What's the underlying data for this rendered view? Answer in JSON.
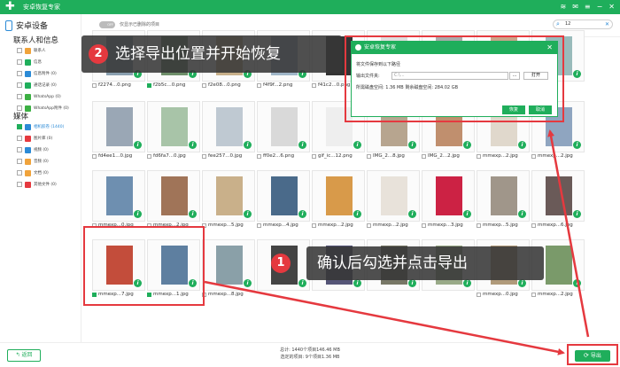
{
  "window": {
    "title": "安卓恢复专家"
  },
  "sidebar": {
    "device_label": "安卓设备",
    "section_contacts": "联系人和信息",
    "contacts_items": [
      {
        "label": "联系人",
        "icon": "contacts-icon",
        "color": "#f0a33b"
      },
      {
        "label": "信息",
        "icon": "message-icon",
        "color": "#1fae5b"
      },
      {
        "label": "信息附件 (0)",
        "icon": "attachment-icon",
        "color": "#2b8ad6"
      },
      {
        "label": "通话记录 (0)",
        "icon": "phone-icon",
        "color": "#1fae5b"
      },
      {
        "label": "WhatsApp (0)",
        "icon": "whatsapp-icon",
        "color": "#3cb043"
      },
      {
        "label": "WhatsApp附件 (0)",
        "icon": "whatsapp-icon",
        "color": "#3cb043"
      }
    ],
    "section_media": "媒体",
    "media_items": [
      {
        "label": "相机胶卷 (1440)",
        "icon": "camera-icon",
        "color": "#2b8ad6",
        "selected": true
      },
      {
        "label": "图片库 (0)",
        "icon": "image-icon",
        "color": "#e5393f"
      },
      {
        "label": "视频 (0)",
        "icon": "video-icon",
        "color": "#2b8ad6"
      },
      {
        "label": "音频 (0)",
        "icon": "audio-icon",
        "color": "#f0a33b"
      },
      {
        "label": "文档 (0)",
        "icon": "document-icon",
        "color": "#f0a33b"
      },
      {
        "label": "其他文件 (0)",
        "icon": "file-icon",
        "color": "#e5393f"
      }
    ]
  },
  "toolbar": {
    "toggle_text": "OFF",
    "toggle_label": "仅显示已删除的项目",
    "search_value": "12"
  },
  "grid": {
    "row1": [
      "f2274...0.png",
      "f2b5c...0.png",
      "f2e08...0.png",
      "f4f9f...2.png",
      "f41c2...0.png",
      "",
      "",
      "",
      ""
    ],
    "row2": [
      "fd4ee1...0.jpg",
      "fd6fa7...0.jpg",
      "fee257...0.jpg",
      "ff0e2...6.png",
      "gif_ic...12.png",
      "IMG_2...8.jpg",
      "IMG_2...2.jpg",
      "mmexp...2.jpg",
      "mmexp...2.jpg"
    ],
    "row3": [
      "mmexp...0.jpg",
      "mmexp...2.jpg",
      "mmexp...5.jpg",
      "mmexp...4.jpg",
      "mmexp...2.jpg",
      "mmexp...2.jpg",
      "mmexp...3.jpg",
      "mmexp...5.jpg",
      "mmexp...6.jpg"
    ],
    "row4": [
      "mmexp...7.jpg",
      "mmexp...1.jpg",
      "mmexp...8.jpg",
      "",
      "",
      "",
      "",
      "mmexp...0.jpg",
      "mmexp...2.jpg"
    ]
  },
  "dialog": {
    "title": "安卓恢复专家",
    "prompt": "将文件保存到以下路径",
    "output_label": "输出文件夹:",
    "output_path": "C:\\...",
    "more_btn": "...",
    "open_btn": "打开",
    "space_text": "所需磁盘空间: 1.36 MB  剩余磁盘空间: 284.02 GB",
    "recover_btn": "恢复",
    "cancel_btn": "取消"
  },
  "callouts": {
    "step2_num": "2",
    "step2_text": "选择导出位置并开始恢复",
    "step1_num": "1",
    "step1_text": "确认后勾选并点击导出"
  },
  "bottom": {
    "back_label": "返回",
    "stats_total": "总计: 1440个项目146.46 MB",
    "stats_selected": "选定的项目: 9个项目1.36 MB",
    "export_label": "导出"
  },
  "colors": {
    "accent": "#1fae5b",
    "highlight": "#e5393f",
    "link": "#2b8ad6"
  }
}
